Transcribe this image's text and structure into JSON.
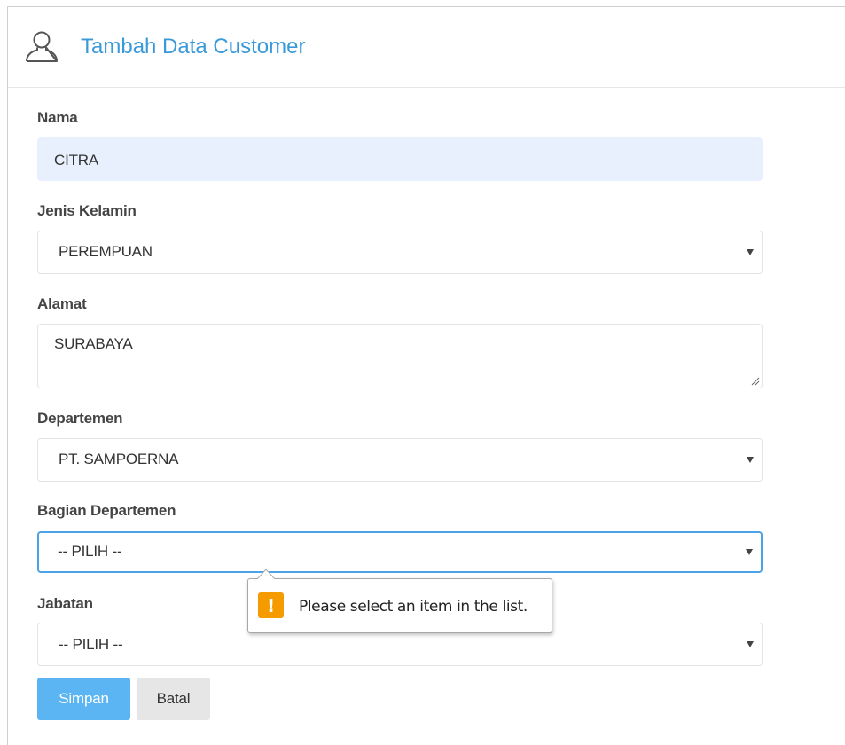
{
  "header": {
    "title": "Tambah Data Customer",
    "icon": "user-outline-icon",
    "title_color": "#3a9ad9"
  },
  "form": {
    "nama": {
      "label": "Nama",
      "value": "CITRA"
    },
    "jenis_kelamin": {
      "label": "Jenis Kelamin",
      "selected": "PEREMPUAN"
    },
    "alamat": {
      "label": "Alamat",
      "value": "SURABAYA"
    },
    "departemen": {
      "label": "Departemen",
      "selected": "PT. SAMPOERNA"
    },
    "bagian_departemen": {
      "label": "Bagian Departemen",
      "selected": "-- PILIH --"
    },
    "jabatan": {
      "label": "Jabatan",
      "selected": "-- PILIH --"
    }
  },
  "buttons": {
    "save_label": "Simpan",
    "cancel_label": "Batal",
    "save_color": "#5bb5f2"
  },
  "validation_tooltip": {
    "icon": "warning-icon",
    "icon_glyph": "!",
    "message": "Please select an item in the list.",
    "icon_color": "#f59b00"
  }
}
